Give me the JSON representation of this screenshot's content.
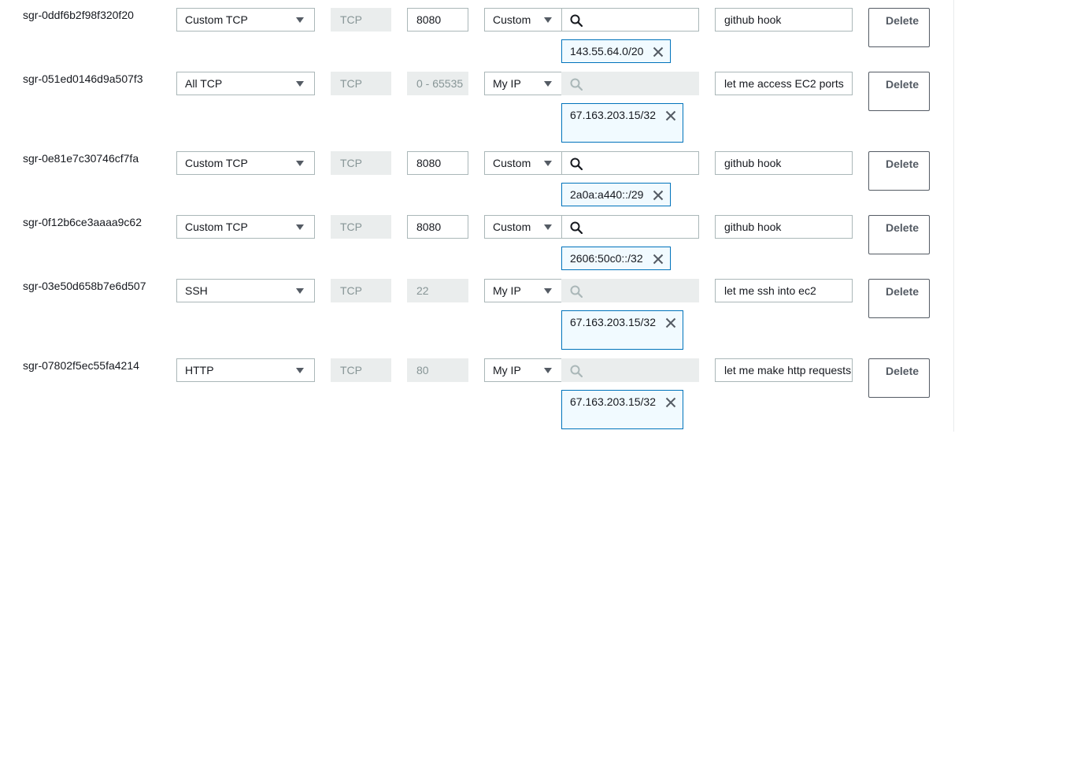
{
  "rules": [
    {
      "id": "sgr-0ddf6b2f98f320f20",
      "type": "Custom TCP",
      "protocol": "TCP",
      "port_range": "8080",
      "port_editable": true,
      "source_type": "Custom",
      "search_editable": true,
      "cidr": "143.55.64.0/20",
      "cidr_wraps": false,
      "description": "github hook",
      "delete_label": "Delete"
    },
    {
      "id": "sgr-051ed0146d9a507f3",
      "type": "All TCP",
      "protocol": "TCP",
      "port_range": "0 - 65535",
      "port_editable": false,
      "source_type": "My IP",
      "search_editable": false,
      "cidr": "67.163.203.15/32",
      "cidr_wraps": true,
      "description": "let me access EC2  ports",
      "delete_label": "Delete"
    },
    {
      "id": "sgr-0e81e7c30746cf7fa",
      "type": "Custom TCP",
      "protocol": "TCP",
      "port_range": "8080",
      "port_editable": true,
      "source_type": "Custom",
      "search_editable": true,
      "cidr": "2a0a:a440::/29",
      "cidr_wraps": false,
      "description": "github hook",
      "delete_label": "Delete"
    },
    {
      "id": "sgr-0f12b6ce3aaaa9c62",
      "type": "Custom TCP",
      "protocol": "TCP",
      "port_range": "8080",
      "port_editable": true,
      "source_type": "Custom",
      "search_editable": true,
      "cidr": "2606:50c0::/32",
      "cidr_wraps": false,
      "description": "github hook",
      "delete_label": "Delete"
    },
    {
      "id": "sgr-03e50d658b7e6d507",
      "type": "SSH",
      "protocol": "TCP",
      "port_range": "22",
      "port_editable": false,
      "source_type": "My IP",
      "search_editable": false,
      "cidr": "67.163.203.15/32",
      "cidr_wraps": true,
      "description": "let me ssh into ec2",
      "delete_label": "Delete"
    },
    {
      "id": "sgr-07802f5ec55fa4214",
      "type": "HTTP",
      "protocol": "TCP",
      "port_range": "80",
      "port_editable": false,
      "source_type": "My IP",
      "search_editable": false,
      "cidr": "67.163.203.15/32",
      "cidr_wraps": true,
      "description": "let me make http requests",
      "delete_label": "Delete"
    }
  ],
  "icons": {
    "type_caret": "caret-down-icon",
    "source_caret": "caret-down-icon",
    "search": "search-icon",
    "remove_token": "close-icon"
  },
  "colors": {
    "token_border": "#0073bb",
    "token_background": "#f1faff",
    "disabled_field": "#eaeded",
    "input_border": "#aab7b8",
    "button_border": "#545b64"
  }
}
